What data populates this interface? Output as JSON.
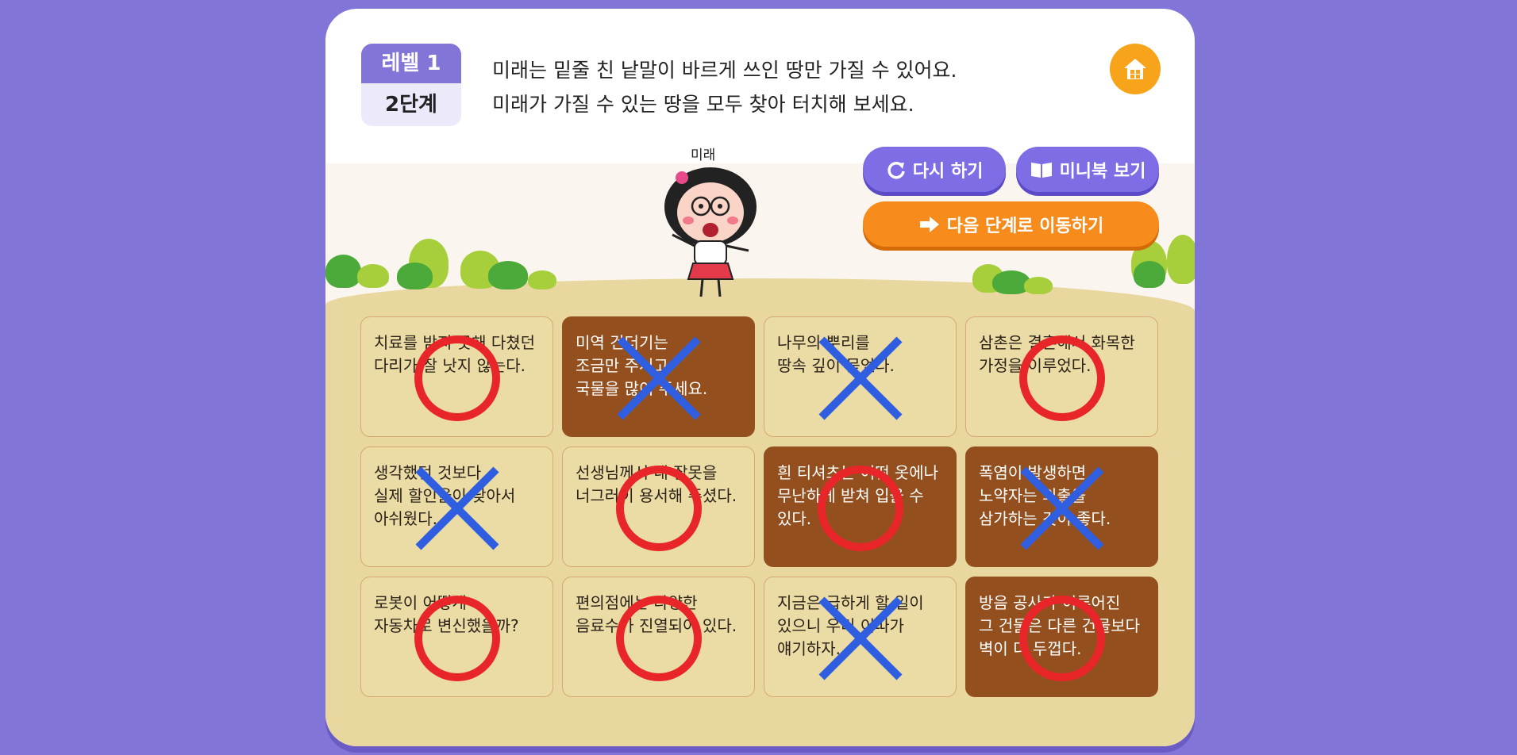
{
  "level": {
    "label": "레벨 1",
    "stage": "2단계"
  },
  "instructions": [
    "미래는 밑줄 친 낱말이 바르게 쓰인 땅만 가질 수 있어요.",
    "미래가 가질 수 있는 땅을 모두 찾아 터치해 보세요."
  ],
  "character": {
    "name": "미래"
  },
  "buttons": {
    "retry": "다시 하기",
    "minibook": "미니북 보기",
    "next": "다음 단계로 이동하기"
  },
  "icons": {
    "home": "home-icon",
    "retry": "refresh-icon",
    "minibook": "book-icon",
    "next": "arrow-right-icon"
  },
  "colors": {
    "background": "#8275d8",
    "correct_mark": "#e8262a",
    "wrong_mark": "#2f5fe0",
    "card_light": "#ebdba5",
    "card_dark": "#944f1f",
    "button_purple": "#7d6ee6",
    "button_orange": "#f78b1b"
  },
  "cards": [
    {
      "lines": [
        "치료를 받지 못해 다쳤던",
        "다리가 잘 낫지 않는다."
      ],
      "selected": false,
      "mark": "O"
    },
    {
      "lines": [
        "미역 건더기는",
        "조금만 주시고",
        "국물을 많이 주세요."
      ],
      "selected": true,
      "mark": "X"
    },
    {
      "lines": [
        "나무의 뿌리를",
        "땅속 깊이 묻었다."
      ],
      "selected": false,
      "mark": "X"
    },
    {
      "lines": [
        "삼촌은 결혼해서 화목한",
        "가정을 이루었다."
      ],
      "selected": false,
      "mark": "O"
    },
    {
      "lines": [
        "생각했던 것보다",
        "실제 할인율이 낮아서",
        "아쉬웠다."
      ],
      "selected": false,
      "mark": "X"
    },
    {
      "lines": [
        "선생님께서 내 잘못을",
        "너그러이 용서해 주셨다."
      ],
      "selected": false,
      "mark": "O"
    },
    {
      "lines": [
        "흰 티셔츠는 어떤 옷에나",
        "무난하게 받쳐 입을 수",
        "있다."
      ],
      "selected": true,
      "mark": "O"
    },
    {
      "lines": [
        "폭염이 발생하면",
        "노약자는 외출을",
        "삼가하는 것이 좋다."
      ],
      "selected": true,
      "mark": "X"
    },
    {
      "lines": [
        "로봇이 어떻게",
        "자동차로 변신했을까?"
      ],
      "selected": false,
      "mark": "O"
    },
    {
      "lines": [
        "편의점에는 다양한",
        "음료수가 진열되어 있다."
      ],
      "selected": false,
      "mark": "O"
    },
    {
      "lines": [
        "지금은 급하게 할 일이",
        "있으니 우리 이따가",
        "얘기하자."
      ],
      "selected": false,
      "mark": "X"
    },
    {
      "lines": [
        "방음 공사가 이루어진",
        "그 건물은 다른 건물보다",
        "벽이 더 두껍다."
      ],
      "selected": true,
      "mark": "O"
    }
  ]
}
